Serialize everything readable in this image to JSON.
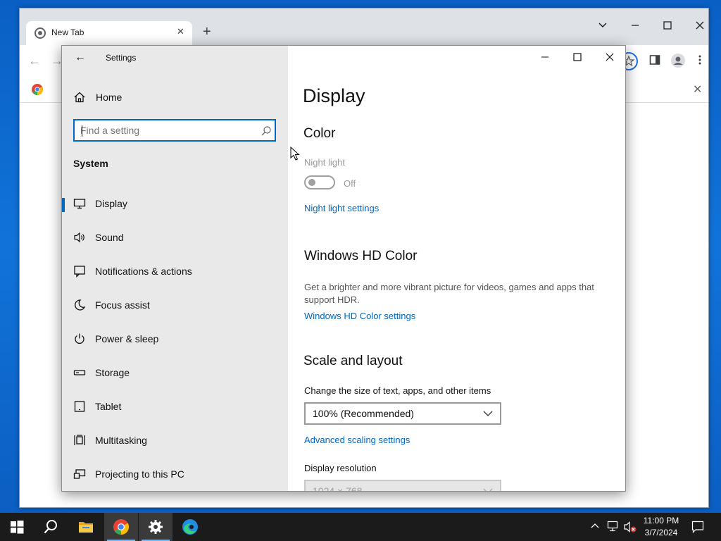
{
  "browser": {
    "tab_title": "New Tab",
    "tab_close": "✕",
    "new_tab": "+",
    "back": "←",
    "forward": "→",
    "bookmark_close": "✕"
  },
  "settings": {
    "app_title": "Settings",
    "home_label": "Home",
    "search_placeholder": "Find a setting",
    "section_label": "System",
    "nav_items": [
      {
        "label": "Display",
        "icon": "monitor-icon",
        "selected": true
      },
      {
        "label": "Sound",
        "icon": "speaker-icon"
      },
      {
        "label": "Notifications & actions",
        "icon": "notification-icon"
      },
      {
        "label": "Focus assist",
        "icon": "moon-icon"
      },
      {
        "label": "Power & sleep",
        "icon": "power-icon"
      },
      {
        "label": "Storage",
        "icon": "storage-icon"
      },
      {
        "label": "Tablet",
        "icon": "tablet-icon"
      },
      {
        "label": "Multitasking",
        "icon": "multitasking-icon"
      },
      {
        "label": "Projecting to this PC",
        "icon": "projecting-icon"
      }
    ],
    "content": {
      "title": "Display",
      "color_heading": "Color",
      "night_light_label": "Night light",
      "night_light_state": "Off",
      "night_light_settings_link": "Night light settings",
      "hdr_heading": "Windows HD Color",
      "hdr_description": "Get a brighter and more vibrant picture for videos, games and apps that support HDR.",
      "hdr_settings_link": "Windows HD Color settings",
      "scale_heading": "Scale and layout",
      "scale_label": "Change the size of text, apps, and other items",
      "scale_value": "100% (Recommended)",
      "advanced_scaling_link": "Advanced scaling settings",
      "resolution_label": "Display resolution",
      "resolution_value": "1024 × 768"
    }
  },
  "taskbar": {
    "time": "11:00 PM",
    "date": "3/7/2024",
    "apps": [
      "start-icon",
      "search-icon",
      "file-explorer-icon",
      "chrome-icon",
      "settings-gear-icon",
      "edge-icon"
    ]
  },
  "colors": {
    "accent": "#0067c0",
    "sidebar_bg": "#e9e9e9",
    "taskbar_bg": "#1b1b1b",
    "desktop": "#0a5fc4"
  }
}
